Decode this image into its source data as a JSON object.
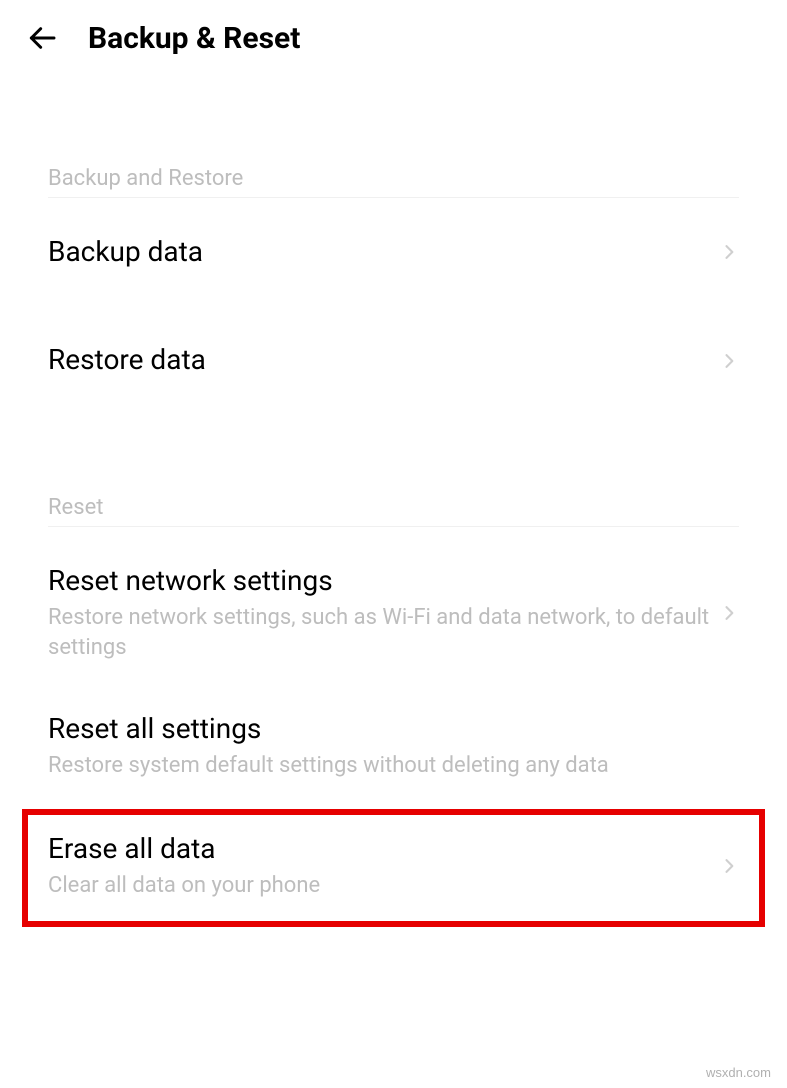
{
  "header": {
    "title": "Backup & Reset"
  },
  "sections": {
    "backup": {
      "header": "Backup and Restore",
      "items": {
        "backup_data": {
          "title": "Backup data"
        },
        "restore_data": {
          "title": "Restore data"
        }
      }
    },
    "reset": {
      "header": "Reset",
      "items": {
        "reset_network": {
          "title": "Reset network settings",
          "subtitle": "Restore network settings, such as Wi-Fi and data network, to default settings"
        },
        "reset_all": {
          "title": "Reset all settings",
          "subtitle": "Restore system default settings without deleting any data"
        },
        "erase_all": {
          "title": "Erase all data",
          "subtitle": "Clear all data on your phone"
        }
      }
    }
  },
  "watermark": "wsxdn.com"
}
